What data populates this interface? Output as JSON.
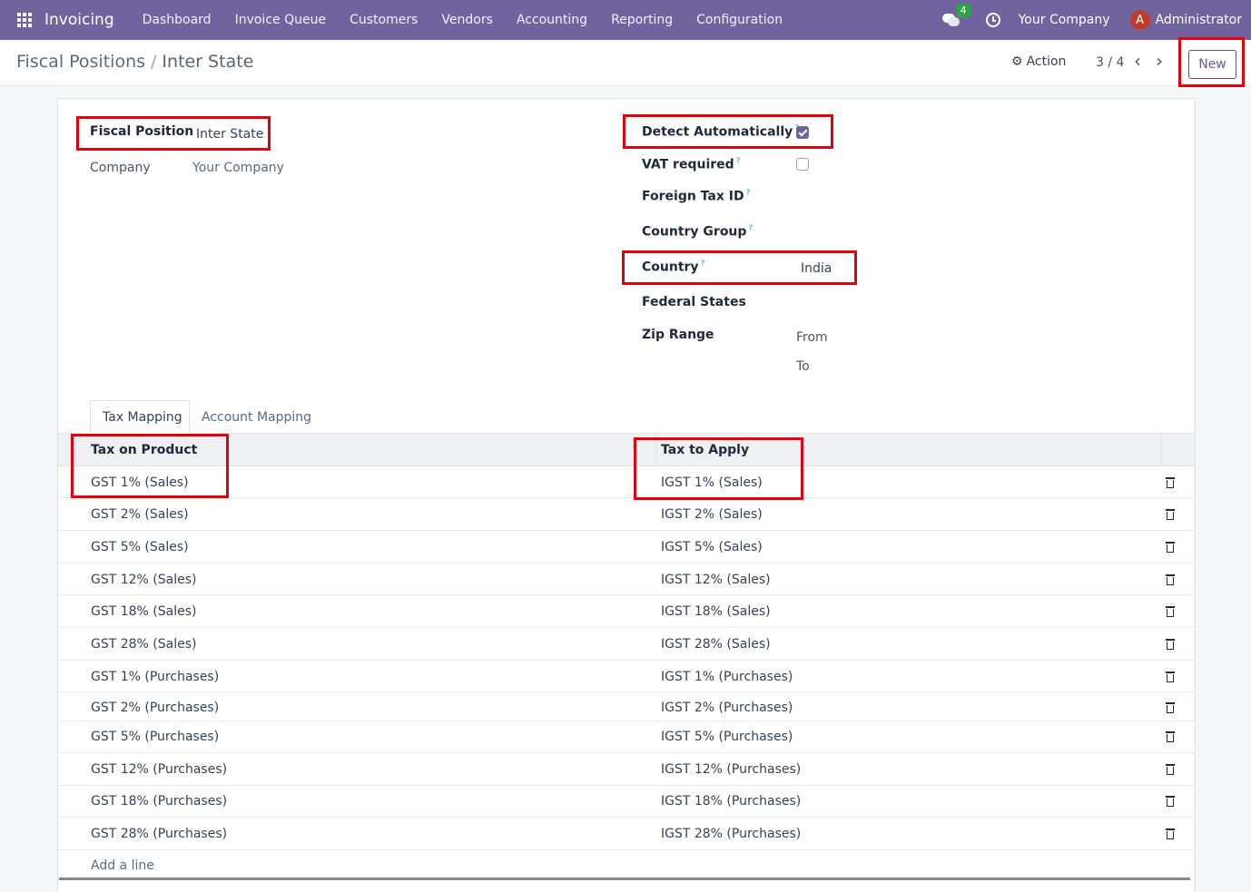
{
  "navbar": {
    "app_name": "Invoicing",
    "menu": [
      "Dashboard",
      "Invoice Queue",
      "Customers",
      "Vendors",
      "Accounting",
      "Reporting",
      "Configuration"
    ],
    "chat_count": "4",
    "company": "Your Company",
    "avatar_letter": "A",
    "user": "Administrator"
  },
  "control": {
    "breadcrumb_parent": "Fiscal Positions",
    "breadcrumb_sep": "/",
    "breadcrumb_current": "Inter State",
    "action_label": "Action",
    "pager": "3 / 4",
    "new_label": "New"
  },
  "form": {
    "fiscal_position_label": "Fiscal Position",
    "fiscal_position_value": "Inter State",
    "company_label": "Company",
    "company_value": "Your Company",
    "detect_auto_label": "Detect Automatically",
    "detect_auto_checked": true,
    "vat_required_label": "VAT required",
    "vat_required_checked": false,
    "foreign_tax_label": "Foreign Tax ID",
    "country_group_label": "Country Group",
    "country_label": "Country",
    "country_value": "India",
    "federal_states_label": "Federal States",
    "zip_range_label": "Zip Range",
    "zip_from": "From",
    "zip_to": "To",
    "help_mark": "?"
  },
  "tabs": [
    "Tax Mapping",
    "Account Mapping"
  ],
  "table": {
    "headers": [
      "Tax on Product",
      "Tax to Apply"
    ],
    "rows": [
      [
        "GST 1% (Sales)",
        "IGST 1% (Sales)"
      ],
      [
        "GST 2% (Sales)",
        "IGST 2% (Sales)"
      ],
      [
        "GST 5% (Sales)",
        "IGST 5% (Sales)"
      ],
      [
        "GST 12% (Sales)",
        "IGST 12% (Sales)"
      ],
      [
        "GST 18% (Sales)",
        "IGST 18% (Sales)"
      ],
      [
        "GST 28% (Sales)",
        "IGST 28% (Sales)"
      ],
      [
        "GST 1% (Purchases)",
        "IGST 1% (Purchases)"
      ],
      [
        "GST 2% (Purchases)",
        "IGST 2% (Purchases)"
      ],
      [
        "GST 5% (Purchases)",
        "IGST 5% (Purchases)"
      ],
      [
        "GST 12% (Purchases)",
        "IGST 12% (Purchases)"
      ],
      [
        "GST 18% (Purchases)",
        "IGST 18% (Purchases)"
      ],
      [
        "GST 28% (Purchases)",
        "IGST 28% (Purchases)"
      ]
    ],
    "add_line": "Add a line"
  },
  "colors": {
    "navbar": "#71639e",
    "highlight": "#e3000f",
    "link": "#5b6b7d"
  }
}
